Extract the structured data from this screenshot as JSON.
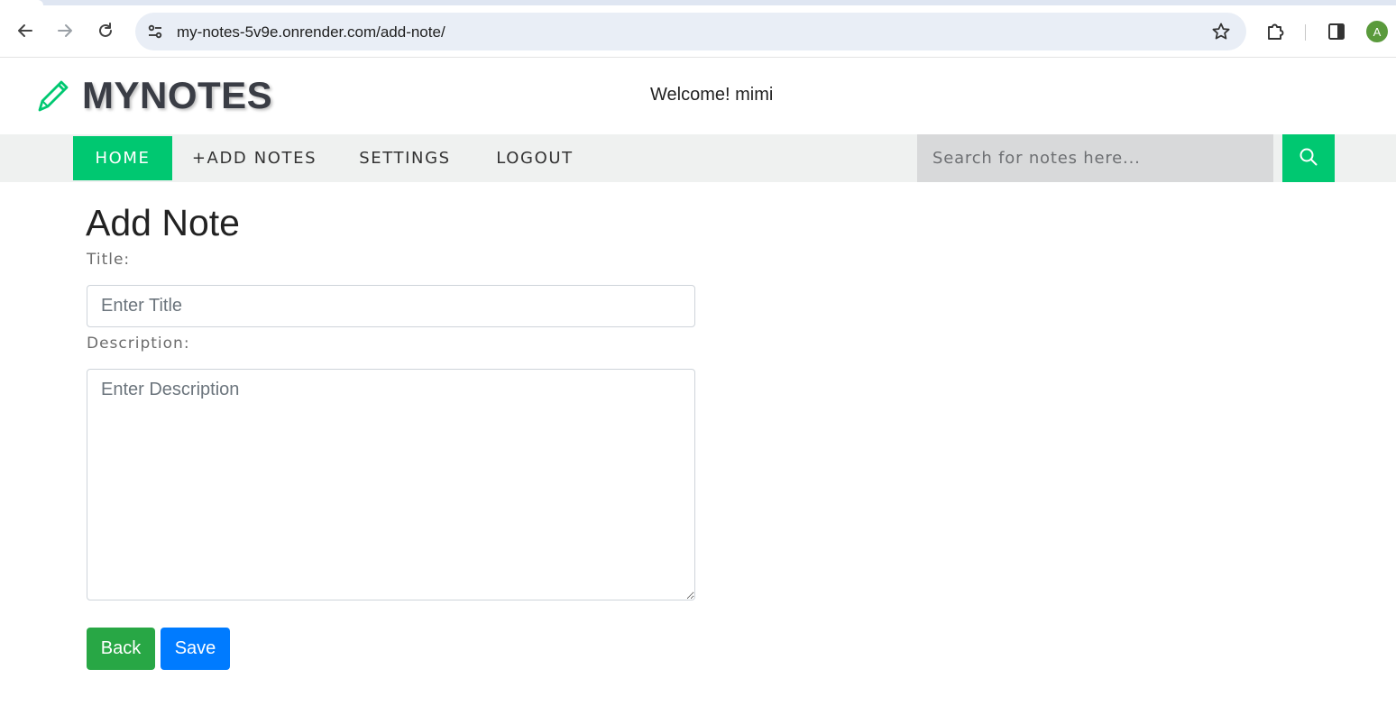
{
  "browser": {
    "url": "my-notes-5v9e.onrender.com/add-note/",
    "profile_initial": "A",
    "icons": [
      "back-arrow-icon",
      "forward-arrow-icon",
      "reload-icon",
      "site-settings-icon",
      "bookmark-star-icon",
      "extensions-icon",
      "side-panel-icon"
    ]
  },
  "header": {
    "logo_text": "MYNOTES",
    "welcome": "Welcome! mimi"
  },
  "nav": {
    "items": [
      {
        "label": "HOME",
        "active": true
      },
      {
        "label": "+ADD NOTES",
        "active": false
      },
      {
        "label": "SETTINGS",
        "active": false
      },
      {
        "label": "LOGOUT",
        "active": false
      }
    ],
    "search_placeholder": "Search for notes here..."
  },
  "form": {
    "heading": "Add Note",
    "title_label": "Title:",
    "title_placeholder": "Enter Title",
    "description_label": "Description:",
    "description_placeholder": "Enter Description",
    "back_label": "Back",
    "save_label": "Save"
  },
  "colors": {
    "accent_green": "#00c871",
    "back_button": "#28a745",
    "save_button": "#007bff",
    "nav_background": "#eff1f0",
    "search_background": "#d8d9da"
  }
}
